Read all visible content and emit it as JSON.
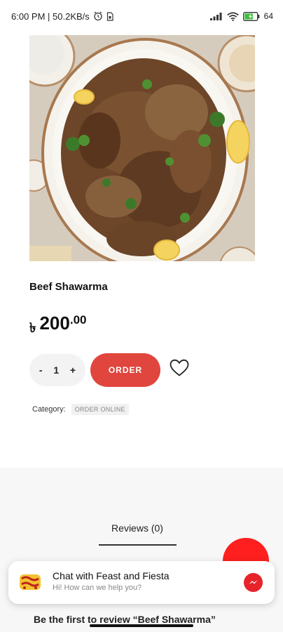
{
  "status_bar": {
    "time_network": "6:00 PM | 50.2KB/s",
    "battery": "64",
    "icons": [
      "alarm-icon",
      "sim-icon",
      "signal-icon",
      "wifi-icon",
      "battery-icon"
    ]
  },
  "product": {
    "image_icon": "food-photo-beef-shawarma",
    "title": "Beef Shawarma",
    "currency": "৳",
    "price_whole": "200",
    "price_cents": ".00"
  },
  "quantity": {
    "minus": "-",
    "value": "1",
    "plus": "+"
  },
  "actions": {
    "order_label": "ORDER",
    "wishlist_icon": "heart-icon"
  },
  "category": {
    "label": "Category:",
    "value": "ORDER ONLINE"
  },
  "reviews": {
    "tab_label": "Reviews (0)",
    "first_review_text": "Be the first to review “Beef Shawarma”"
  },
  "chat": {
    "logo_icon": "feast-and-fiesta-logo",
    "title": "Chat with Feast and Fiesta",
    "subtitle": "Hi! How can we help you?",
    "messenger_icon": "messenger-icon"
  },
  "colors": {
    "accent": "#e0463e",
    "fab": "#ff1f1f",
    "messenger": "#e8232a"
  }
}
